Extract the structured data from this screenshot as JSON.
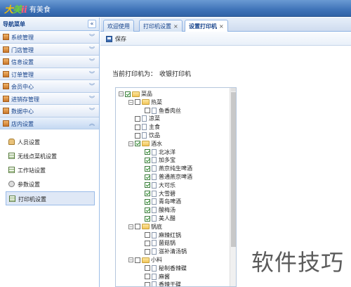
{
  "app": {
    "logo_letters": [
      "大",
      "美",
      "ii"
    ],
    "title": "有美食"
  },
  "sidebar": {
    "title": "导航菜单",
    "collapse_icon": "«",
    "sections": [
      {
        "label": "系统管理"
      },
      {
        "label": "门店管理"
      },
      {
        "label": "信息设置"
      },
      {
        "label": "订单管理"
      },
      {
        "label": "会员中心"
      },
      {
        "label": "进销存管理"
      },
      {
        "label": "数据中心"
      },
      {
        "label": "店内设置",
        "open": true
      }
    ],
    "subitems": [
      {
        "label": "人员设置",
        "icon": "user-icon"
      },
      {
        "label": "无线点菜机设置",
        "icon": "grid-icon"
      },
      {
        "label": "工作站设置",
        "icon": "grid-icon"
      },
      {
        "label": "参数设置",
        "icon": "gear-icon"
      },
      {
        "label": "打印机设置",
        "icon": "grid-icon",
        "active": true
      }
    ]
  },
  "tabs": [
    {
      "label": "欢迎使用",
      "closable": false
    },
    {
      "label": "打印机设置",
      "closable": true
    },
    {
      "label": "设置打印机",
      "closable": true,
      "active": true
    }
  ],
  "toolbar": {
    "save_label": "保存"
  },
  "printer": {
    "label": "当前打印机为：",
    "name": "收银打印机"
  },
  "tree": [
    {
      "label": "菜品",
      "level": 0,
      "type": "folder",
      "checked": true,
      "expanded": true
    },
    {
      "label": "热菜",
      "level": 1,
      "type": "folder",
      "checked": false,
      "expanded": true
    },
    {
      "label": "鱼香肉丝",
      "level": 2,
      "type": "leaf",
      "checked": false
    },
    {
      "label": "凉菜",
      "level": 1,
      "type": "leaf",
      "checked": false
    },
    {
      "label": "主食",
      "level": 1,
      "type": "leaf",
      "checked": false
    },
    {
      "label": "饮品",
      "level": 1,
      "type": "leaf",
      "checked": false
    },
    {
      "label": "酒水",
      "level": 1,
      "type": "folder",
      "checked": true,
      "expanded": true
    },
    {
      "label": "北冰洋",
      "level": 2,
      "type": "leaf",
      "checked": true
    },
    {
      "label": "加多宝",
      "level": 2,
      "type": "leaf",
      "checked": true
    },
    {
      "label": "燕京纯生啤酒",
      "level": 2,
      "type": "leaf",
      "checked": true
    },
    {
      "label": "普通燕京啤酒",
      "level": 2,
      "type": "leaf",
      "checked": true
    },
    {
      "label": "大可乐",
      "level": 2,
      "type": "leaf",
      "checked": true
    },
    {
      "label": "大雪碧",
      "level": 2,
      "type": "leaf",
      "checked": true
    },
    {
      "label": "青岛啤酒",
      "level": 2,
      "type": "leaf",
      "checked": true
    },
    {
      "label": "酸梅汤",
      "level": 2,
      "type": "leaf",
      "checked": true
    },
    {
      "label": "美人醋",
      "level": 2,
      "type": "leaf",
      "checked": true
    },
    {
      "label": "锅底",
      "level": 1,
      "type": "folder",
      "checked": false,
      "expanded": true
    },
    {
      "label": "麻辣红锅",
      "level": 2,
      "type": "leaf",
      "checked": false
    },
    {
      "label": "菌菇锅",
      "level": 2,
      "type": "leaf",
      "checked": false
    },
    {
      "label": "滋补清汤锅",
      "level": 2,
      "type": "leaf",
      "checked": false
    },
    {
      "label": "小料",
      "level": 1,
      "type": "folder",
      "checked": false,
      "expanded": true
    },
    {
      "label": "秘制香辣碟",
      "level": 2,
      "type": "leaf",
      "checked": false
    },
    {
      "label": "麻酱",
      "level": 2,
      "type": "leaf",
      "checked": false
    },
    {
      "label": "香辣干碟",
      "level": 2,
      "type": "leaf",
      "checked": false
    }
  ],
  "watermark": "软件技巧"
}
